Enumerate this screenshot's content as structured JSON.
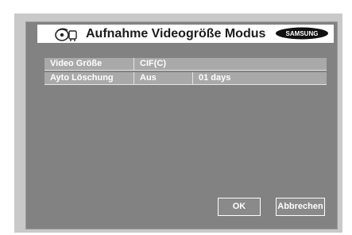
{
  "title": "Aufnahme Videogröße Modus",
  "brand": "SAMSUNG",
  "icons": {
    "title": "tape-recorder-icon",
    "brand": "samsung-logo"
  },
  "settings": [
    {
      "label": "Video Größe",
      "value": "CIF(C)"
    },
    {
      "label": "Ayto Löschung",
      "value": "Aus",
      "extra": "01 days"
    }
  ],
  "buttons": {
    "ok": "OK",
    "cancel": "Abbrechen"
  },
  "colors": {
    "panel": "#828282",
    "row": "#a9a9a9",
    "title_bar": "#ffffff",
    "frame": "#c9c9c9"
  }
}
